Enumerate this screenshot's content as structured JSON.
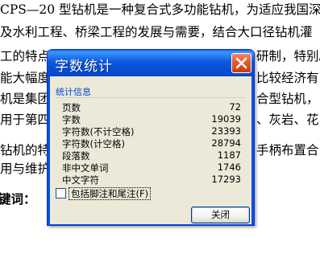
{
  "document": {
    "lines": [
      "CPS—20 型钻机是一种复合式多功能钻机，为适应我国深",
      "及水利工程、桥梁工程的发展与需要，结合大口径钻机灌",
      "工的特点",
      "能大幅度",
      "机是集团",
      "用于第四",
      "钻机的特",
      "用与维护"
    ],
    "right_fragments": [
      "研制，特别。",
      "比较经济有",
      "合型钻机，",
      "、灰岩、花",
      "手柄布置合"
    ],
    "keyword_label": "键词："
  },
  "dialog": {
    "title": "字数统计",
    "group_title": "统计信息",
    "stats": [
      {
        "label": "页数",
        "value": "72"
      },
      {
        "label": "字数",
        "value": "19039"
      },
      {
        "label": "字符数(不计空格)",
        "value": "23393"
      },
      {
        "label": "字符数(计空格)",
        "value": "28794"
      },
      {
        "label": "段落数",
        "value": "1187"
      },
      {
        "label": "非中文单词",
        "value": "1746"
      },
      {
        "label": "中文字符",
        "value": "17293"
      }
    ],
    "checkbox_label": "包括脚注和尾注(F)",
    "checkbox_checked": false,
    "close_button_label": "关闭",
    "colors": {
      "titlebar": "#0a5ae0",
      "close_red": "#e45a2c",
      "group_title": "#0046d5",
      "body_bg": "#ece9d8"
    },
    "icons": {
      "close": "close-x-icon"
    }
  }
}
